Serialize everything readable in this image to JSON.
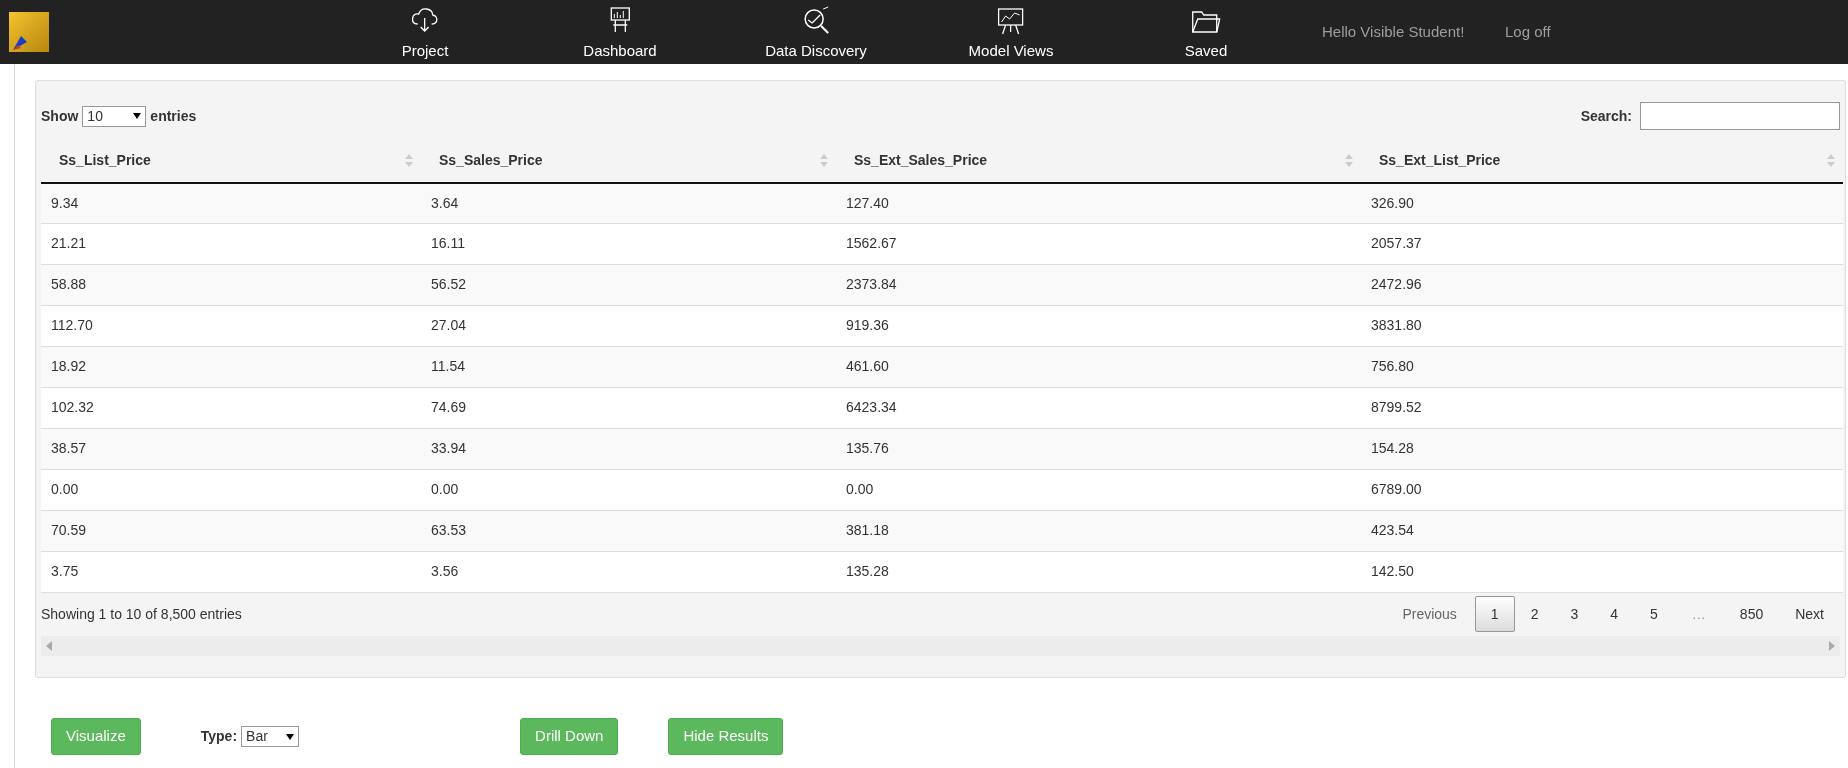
{
  "nav": {
    "items": [
      {
        "label": "Project",
        "kind": "cloud"
      },
      {
        "label": "Dashboard",
        "kind": "board"
      },
      {
        "label": "Data Discovery",
        "kind": "magnifier"
      },
      {
        "label": "Model Views",
        "kind": "easel"
      },
      {
        "label": "Saved",
        "kind": "folder"
      }
    ],
    "greeting": "Hello Visible Student!",
    "logoff": "Log off"
  },
  "table_controls": {
    "show_label": "Show",
    "page_length": "10",
    "entries_label": "entries",
    "search_label": "Search:"
  },
  "table": {
    "columns": [
      "Ss_List_Price",
      "Ss_Sales_Price",
      "Ss_Ext_Sales_Price",
      "Ss_Ext_List_Price"
    ],
    "rows": [
      [
        "9.34",
        "3.64",
        "127.40",
        "326.90"
      ],
      [
        "21.21",
        "16.11",
        "1562.67",
        "2057.37"
      ],
      [
        "58.88",
        "56.52",
        "2373.84",
        "2472.96"
      ],
      [
        "112.70",
        "27.04",
        "919.36",
        "3831.80"
      ],
      [
        "18.92",
        "11.54",
        "461.60",
        "756.80"
      ],
      [
        "102.32",
        "74.69",
        "6423.34",
        "8799.52"
      ],
      [
        "38.57",
        "33.94",
        "135.76",
        "154.28"
      ],
      [
        "0.00",
        "0.00",
        "0.00",
        "6789.00"
      ],
      [
        "70.59",
        "63.53",
        "381.18",
        "423.54"
      ],
      [
        "3.75",
        "3.56",
        "135.28",
        "142.50"
      ]
    ]
  },
  "info": "Showing 1 to 10 of 8,500 entries",
  "pagination": [
    {
      "label": "Previous",
      "kind": "prev",
      "disabled": true,
      "selected": false
    },
    {
      "label": "1",
      "kind": "page",
      "selected": true
    },
    {
      "label": "2",
      "kind": "page",
      "selected": false
    },
    {
      "label": "3",
      "kind": "page",
      "selected": false
    },
    {
      "label": "4",
      "kind": "page",
      "selected": false
    },
    {
      "label": "5",
      "kind": "page",
      "selected": false
    },
    {
      "label": "…",
      "kind": "ellipsis"
    },
    {
      "label": "850",
      "kind": "page",
      "selected": false
    },
    {
      "label": "Next",
      "kind": "next",
      "disabled": false,
      "selected": false
    }
  ],
  "actions": {
    "visualize": "Visualize",
    "type_label": "Type:",
    "type_value": "Bar",
    "drill_down": "Drill Down",
    "hide_results": "Hide Results"
  }
}
